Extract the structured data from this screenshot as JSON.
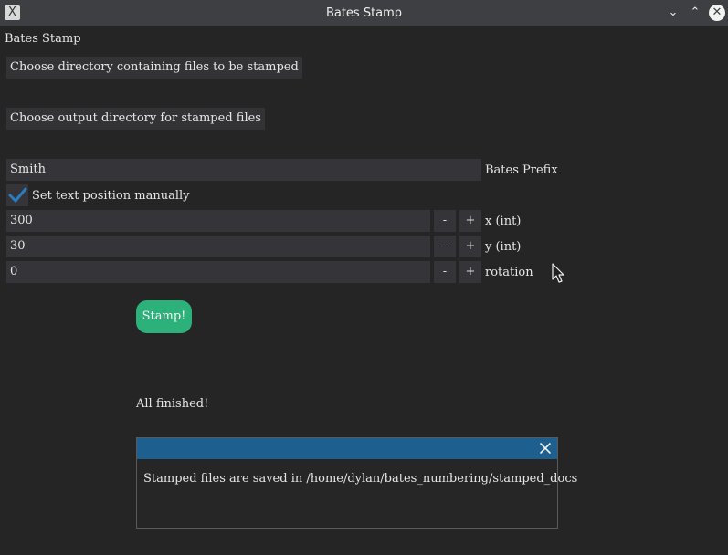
{
  "window": {
    "title": "Bates Stamp",
    "icons": {
      "app": "app-x-icon",
      "minimize": "chevron-down-icon",
      "maximize": "chevron-up-icon",
      "close": "close-icon"
    },
    "glyphs": {
      "app": "X",
      "minimize": "⌄",
      "maximize": "⌃",
      "close": "✕"
    }
  },
  "main": {
    "heading": "Bates Stamp",
    "choose_input_label": "Choose directory containing files to be stamped",
    "choose_output_label": "Choose output directory for stamped files",
    "prefix": {
      "value": "Smith",
      "label": "Bates Prefix"
    },
    "manual_position": {
      "label": "Set text position manually",
      "checked": true
    },
    "coords": [
      {
        "value": "300",
        "label": "x (int)",
        "minus": "-",
        "plus": "+"
      },
      {
        "value": "30",
        "label": "y (int)",
        "minus": "-",
        "plus": "+"
      },
      {
        "value": "0",
        "label": "rotation",
        "minus": "-",
        "plus": "+"
      }
    ],
    "stamp_label": "Stamp!",
    "status": "All finished!"
  },
  "notification": {
    "message": "Stamped files are saved in /home/dylan/bates_numbering/stamped_docs",
    "close_icon": "close-icon"
  },
  "colors": {
    "background": "#252525",
    "titlebar": "#3d3f42",
    "field": "#353539",
    "accent_green": "#2db17b",
    "notify_bar": "#1d5f8f",
    "check_blue": "#2a7dc0"
  }
}
